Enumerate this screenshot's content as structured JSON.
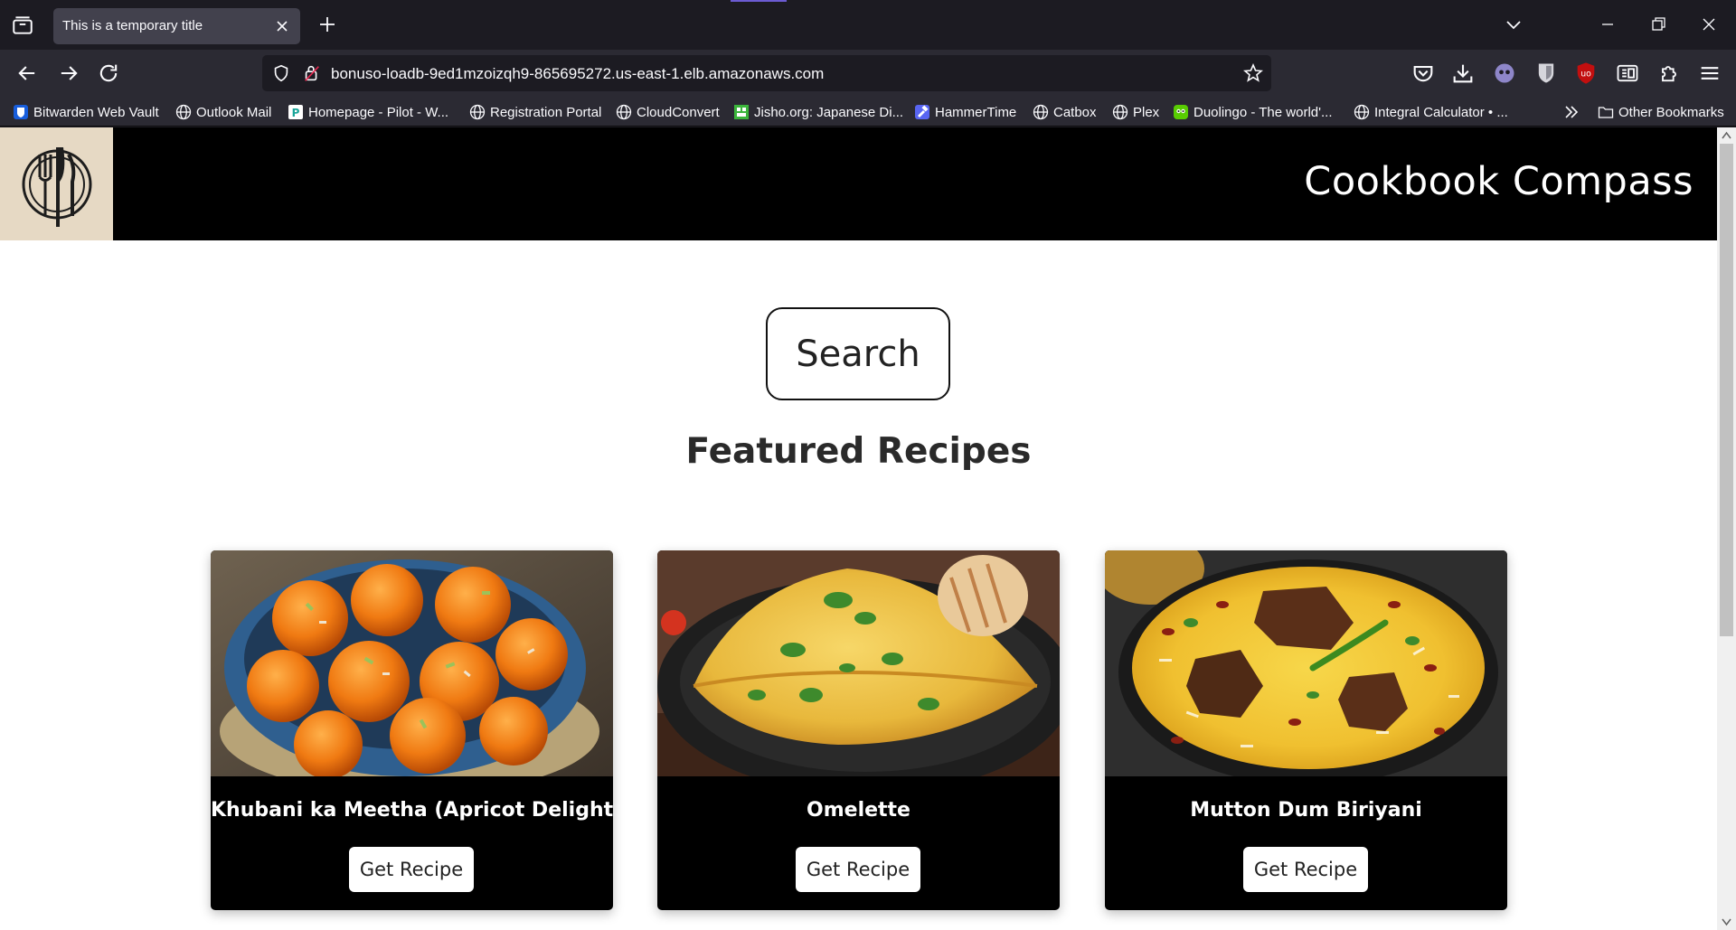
{
  "browser": {
    "tab": {
      "title": "This is a temporary title"
    },
    "url": "bonuso-loadb-9ed1mzoizqh9-865695272.us-east-1.elb.amazonaws.com",
    "bookmarks": [
      {
        "label": "Bitwarden Web Vault",
        "icon": "bitwarden-icon"
      },
      {
        "label": "Outlook Mail",
        "icon": "globe-icon"
      },
      {
        "label": "Homepage - Pilot - W...",
        "icon": "pilot-icon"
      },
      {
        "label": "Registration Portal",
        "icon": "globe-icon"
      },
      {
        "label": "CloudConvert",
        "icon": "globe-icon"
      },
      {
        "label": "Jisho.org: Japanese Di...",
        "icon": "jisho-icon"
      },
      {
        "label": "HammerTime",
        "icon": "hammertime-icon"
      },
      {
        "label": "Catbox",
        "icon": "globe-icon"
      },
      {
        "label": "Plex",
        "icon": "globe-icon"
      },
      {
        "label": "Duolingo - The world'...",
        "icon": "duolingo-icon"
      },
      {
        "label": "Integral Calculator • ...",
        "icon": "globe-icon"
      }
    ],
    "other_bookmarks": "Other Bookmarks"
  },
  "site": {
    "title": "Cookbook Compass",
    "search_label": "Search",
    "featured_heading": "Featured Recipes",
    "recipes": [
      {
        "name": "Khubani ka Meetha (Apricot Delight)",
        "button": "Get Recipe",
        "image": "apricot-dessert-image"
      },
      {
        "name": "Omelette",
        "button": "Get Recipe",
        "image": "omelette-image"
      },
      {
        "name": "Mutton Dum Biriyani",
        "button": "Get Recipe",
        "image": "biryani-image"
      }
    ]
  },
  "colors": {
    "tabstrip": "#1c1b22",
    "toolbar": "#2b2a33",
    "header": "#000000",
    "logo_bg": "#e6d9c4"
  }
}
